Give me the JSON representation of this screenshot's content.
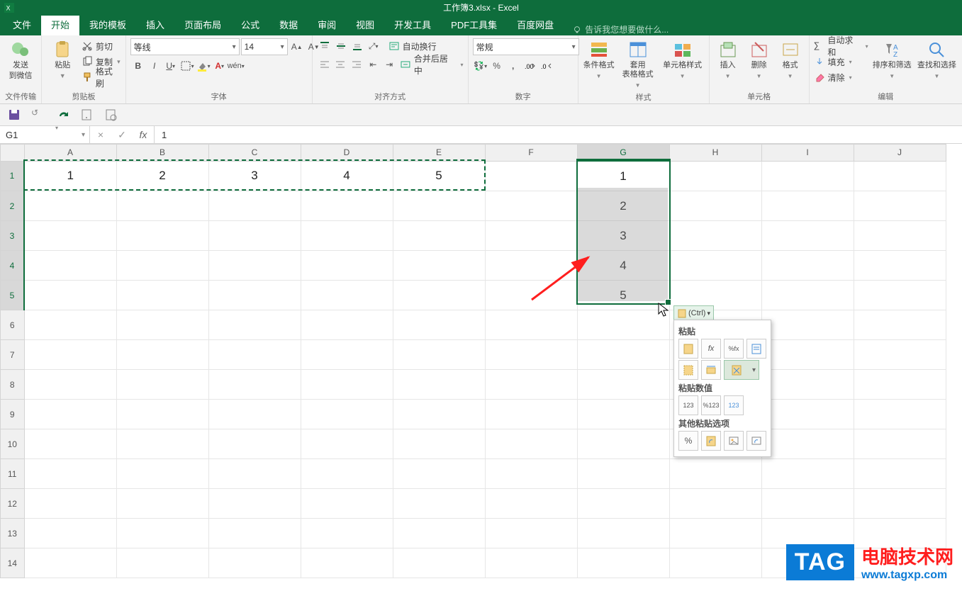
{
  "app": {
    "title": "工作簿3.xlsx - Excel"
  },
  "tabs": {
    "file": "文件",
    "home": "开始",
    "mytpl": "我的模板",
    "insert": "插入",
    "layout": "页面布局",
    "formulas": "公式",
    "data": "数据",
    "review": "审阅",
    "view": "视图",
    "dev": "开发工具",
    "pdf": "PDF工具集",
    "netdisk": "百度网盘",
    "tell": "告诉我您想要做什么..."
  },
  "ribbon": {
    "wechat": {
      "line1": "发送",
      "line2": "到微信",
      "group": "文件传输"
    },
    "clipboard": {
      "paste": "粘贴",
      "cut": "剪切",
      "copy": "复制",
      "painter": "格式刷",
      "group": "剪贴板"
    },
    "font": {
      "name": "等线",
      "size": "14",
      "group": "字体"
    },
    "align": {
      "wrap": "自动换行",
      "merge": "合并后居中",
      "group": "对齐方式"
    },
    "number": {
      "format": "常规",
      "group": "数字"
    },
    "styles": {
      "cond": "条件格式",
      "table": "套用\n表格格式",
      "cell": "单元格样式",
      "group": "样式"
    },
    "cells": {
      "insert": "插入",
      "delete": "删除",
      "format": "格式",
      "group": "单元格"
    },
    "editing": {
      "sum": "自动求和",
      "fill": "填充",
      "clear": "清除",
      "sort": "排序和筛选",
      "find": "查找和选择",
      "group": "编辑"
    }
  },
  "namebox": "G1",
  "formula": "1",
  "columns": [
    "A",
    "B",
    "C",
    "D",
    "E",
    "F",
    "G",
    "H",
    "I",
    "J"
  ],
  "rows": [
    "1",
    "2",
    "3",
    "4",
    "5",
    "6",
    "7",
    "8",
    "9",
    "10",
    "11",
    "12",
    "13",
    "14"
  ],
  "rowdata": {
    "A1": "1",
    "B1": "2",
    "C1": "3",
    "D1": "4",
    "E1": "5"
  },
  "paste_col": {
    "G1": "1",
    "G2": "2",
    "G3": "3",
    "G4": "4",
    "G5": "5"
  },
  "pastebtn_label": "(Ctrl)",
  "pastepanel": {
    "sec1": "粘贴",
    "sec2": "粘贴数值",
    "sec3": "其他粘贴选项"
  },
  "watermark": {
    "tag": "TAG",
    "l1": "电脑技术网",
    "l2": "www.tagxp.com"
  }
}
